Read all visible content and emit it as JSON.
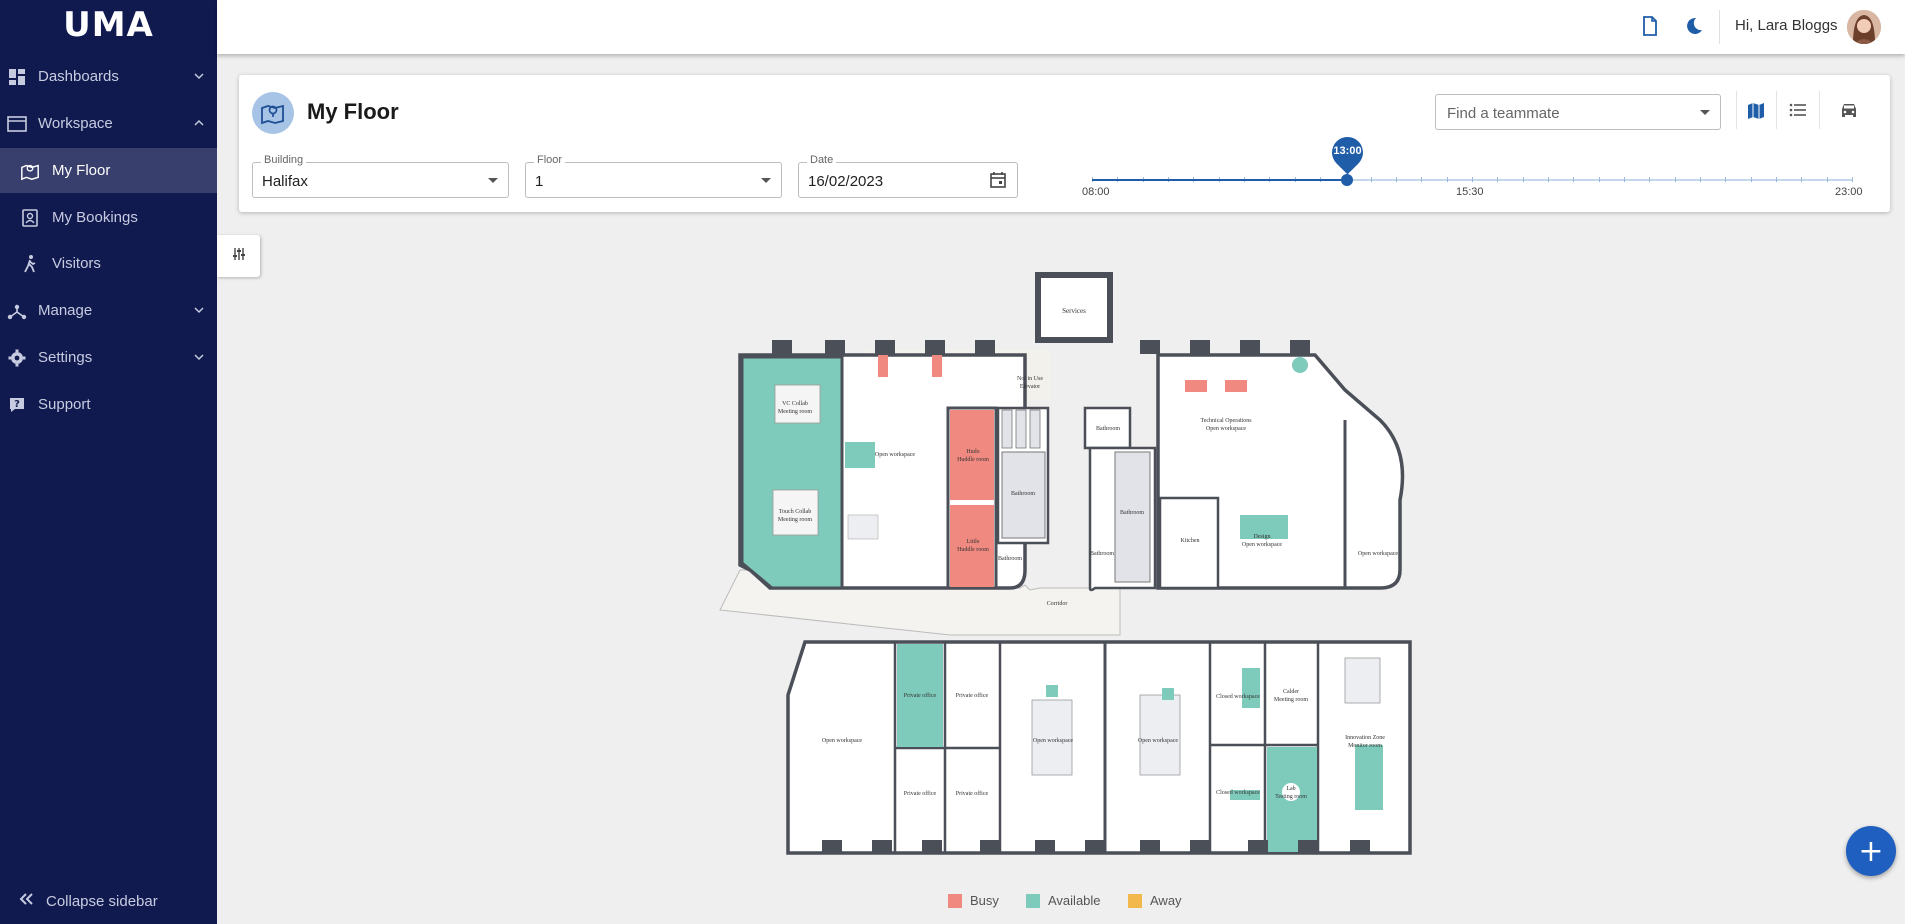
{
  "app": {
    "logo": "UMA"
  },
  "sidebar": {
    "items": [
      {
        "label": "Dashboards",
        "icon": "dashboard-icon"
      },
      {
        "label": "Workspace",
        "icon": "workspace-icon"
      },
      {
        "label": "My Floor",
        "icon": "floor-map-icon",
        "active": true
      },
      {
        "label": "My Bookings",
        "icon": "bookings-icon"
      },
      {
        "label": "Visitors",
        "icon": "walking-person-icon"
      },
      {
        "label": "Manage",
        "icon": "network-icon"
      },
      {
        "label": "Settings",
        "icon": "gear-icon"
      },
      {
        "label": "Support",
        "icon": "help-icon"
      }
    ],
    "collapse_label": "Collapse sidebar"
  },
  "topbar": {
    "greeting": "Hi, Lara Bloggs"
  },
  "header": {
    "title": "My Floor",
    "building": {
      "label": "Building",
      "value": "Halifax"
    },
    "floor": {
      "label": "Floor",
      "value": "1"
    },
    "date": {
      "label": "Date",
      "value": "16/02/2023"
    },
    "find_placeholder": "Find a teammate",
    "timeline": {
      "start": "08:00",
      "mid": "15:30",
      "end": "23:00",
      "current": "13:00",
      "position": 0.333
    }
  },
  "floorplan": {
    "rooms": {
      "services": "Services",
      "not_in_use": "Not in Use",
      "elevator": "Elevator",
      "vc_collab": "VC Collab",
      "meeting_room": "Meeting room",
      "touch_collab": "Touch Collab",
      "open_workspace": "Open workspace",
      "hudo": "Hudo",
      "huddle_room": "Huddle room",
      "little": "Little",
      "bathroom": "Bathroom",
      "technical_ops": "Technical Operations",
      "kitchen": "Kitchen",
      "design": "Design",
      "corridor": "Corridor",
      "private_office": "Private office",
      "closed_workspace": "Closed workspace",
      "calder": "Calder",
      "innovation_zone": "Innovation Zone",
      "monitor_room": "Monitor room",
      "lab": "Lab",
      "testing_room": "Testing room"
    }
  },
  "legend": [
    {
      "label": "Busy",
      "color": "#f08a80"
    },
    {
      "label": "Available",
      "color": "#7fcbbb"
    },
    {
      "label": "Away",
      "color": "#f2b84b"
    }
  ],
  "colors": {
    "sidebar": "#101a4f",
    "accent": "#1f5da8",
    "busy": "#f08a80",
    "available": "#7fcbbb",
    "away": "#f2b84b"
  }
}
